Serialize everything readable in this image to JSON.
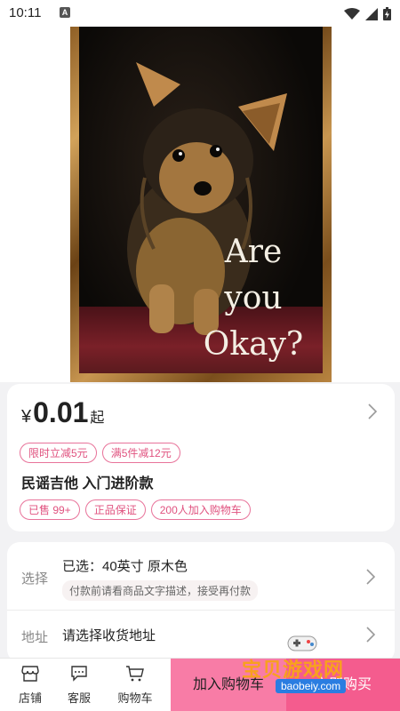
{
  "status_bar": {
    "time": "10:11",
    "notification_glyph": "A"
  },
  "hero": {
    "caption_lines": [
      "Are",
      "you",
      "Okay?"
    ]
  },
  "price": {
    "currency": "¥",
    "amount": "0.01",
    "suffix": "起"
  },
  "promo_tags": [
    "限时立减5元",
    "满5件减12元"
  ],
  "product_title": "民谣吉他 入门进阶款",
  "info_tags": [
    "已售 99+",
    "正品保证",
    "200人加入购物车"
  ],
  "selection": {
    "label": "选择",
    "value": "已选：40英寸 原木色",
    "note": "付款前请看商品文字描述，接受再付款"
  },
  "address": {
    "label": "地址",
    "value": "请选择收货地址"
  },
  "bottom_nav": {
    "store": "店铺",
    "service": "客服",
    "cart": "购物车",
    "add_to_cart": "加入购物车",
    "buy_now": "立即购买"
  },
  "watermark": {
    "title": "宝贝游戏网",
    "url": "baobeiy.com"
  },
  "colors": {
    "accent": "#f45c8e",
    "accent_light": "#f87ca6",
    "tag_border": "#e8739a"
  }
}
